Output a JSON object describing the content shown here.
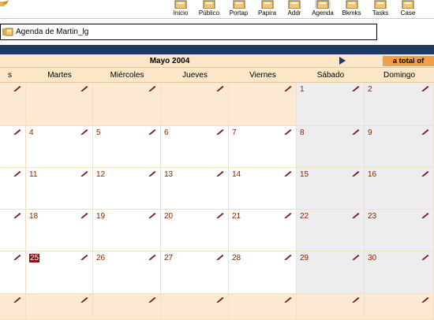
{
  "toolbar": {
    "buttons": [
      {
        "label": "Inicio",
        "icon": "home-icon"
      },
      {
        "label": "Público",
        "icon": "public-icon"
      },
      {
        "label": "Portap",
        "icon": "briefcase-icon"
      },
      {
        "label": "Papira",
        "icon": "papers-icon"
      },
      {
        "label": "Addr",
        "icon": "address-book-icon"
      },
      {
        "label": "Agenda",
        "icon": "agenda-icon",
        "active": true
      },
      {
        "label": "Bkmks",
        "icon": "bookmarks-icon"
      },
      {
        "label": "Tasks",
        "icon": "tasks-icon"
      },
      {
        "label": "Case",
        "icon": "case-icon"
      }
    ]
  },
  "breadcrumb": {
    "text": "Agenda de Martin_lg"
  },
  "calendar": {
    "month_title": "Mayo 2004",
    "total_label": "a total of",
    "day_names": [
      "s",
      "Martes",
      "Miércoles",
      "Jueves",
      "Viernes",
      "Sábado",
      "Domingo"
    ],
    "weeks": [
      [
        "",
        "",
        "",
        "",
        "",
        "1",
        "2"
      ],
      [
        "",
        "4",
        "5",
        "6",
        "7",
        "8",
        "9"
      ],
      [
        "",
        "11",
        "12",
        "13",
        "14",
        "15",
        "16"
      ],
      [
        "",
        "18",
        "19",
        "20",
        "21",
        "22",
        "23"
      ],
      [
        "",
        "25",
        "26",
        "27",
        "28",
        "29",
        "30"
      ],
      [
        "",
        "",
        "",
        "",
        "",
        "",
        ""
      ]
    ],
    "prev_month_weeks": [
      0,
      5
    ],
    "today": "25"
  },
  "colors": {
    "accent": "#f0a04a",
    "header_bg": "#fbe7c8",
    "band": "#1f3a63",
    "today": "#8c1212"
  }
}
